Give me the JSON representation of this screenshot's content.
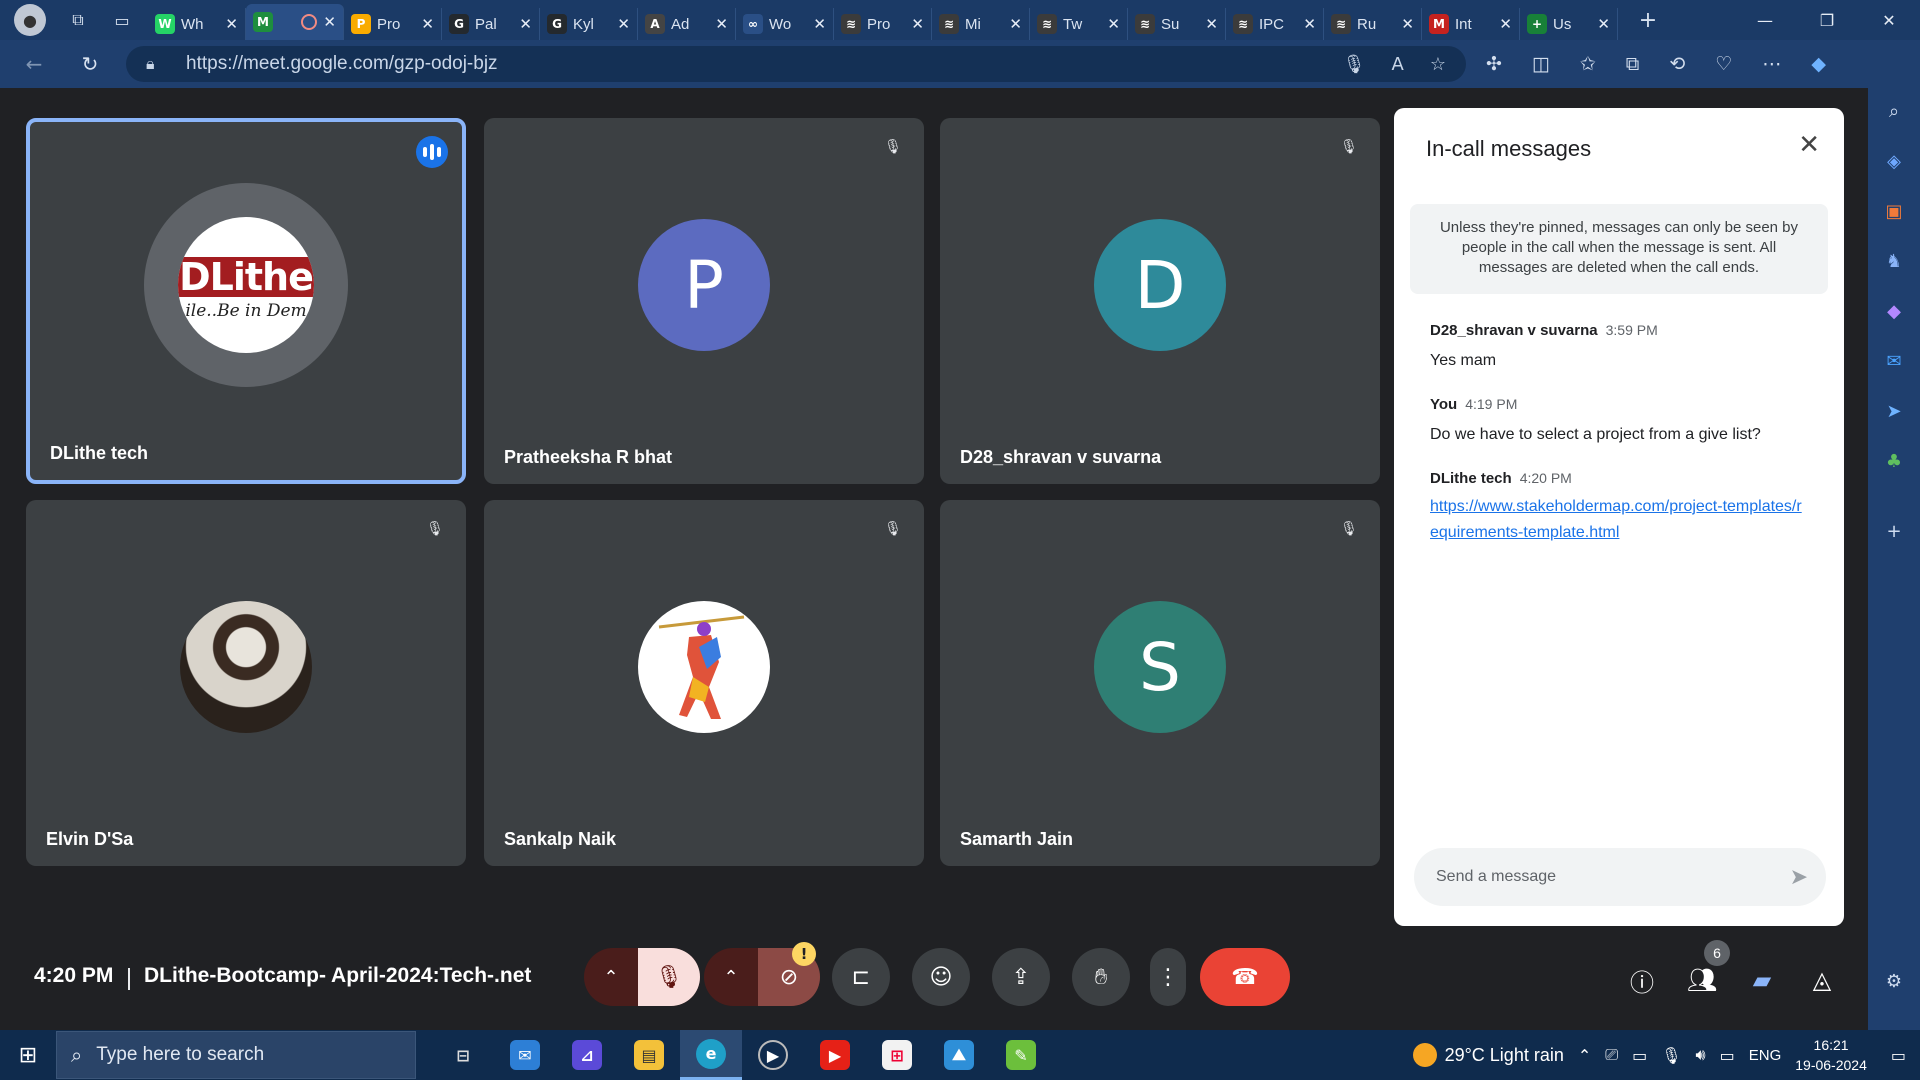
{
  "browser": {
    "tabs": [
      {
        "label": "Wh",
        "fav": "W",
        "color": "#25d366"
      },
      {
        "label": "",
        "fav": "M",
        "color": "#1e8e3e",
        "active": true
      },
      {
        "label": "Pro",
        "fav": "P",
        "color": "#f9ab00"
      },
      {
        "label": "Pal",
        "fav": "G",
        "color": "#24292e"
      },
      {
        "label": "Kyl",
        "fav": "G",
        "color": "#24292e"
      },
      {
        "label": "Ad",
        "fav": "A",
        "color": "#444"
      },
      {
        "label": "Wo",
        "fav": "∞",
        "color": "#2a4f86"
      },
      {
        "label": "Pro",
        "fav": "≋",
        "color": "#3b3b3b"
      },
      {
        "label": "Mi",
        "fav": "≋",
        "color": "#3b3b3b"
      },
      {
        "label": "Tw",
        "fav": "≋",
        "color": "#3b3b3b"
      },
      {
        "label": "Su",
        "fav": "≋",
        "color": "#3b3b3b"
      },
      {
        "label": "IPC",
        "fav": "≋",
        "color": "#3b3b3b"
      },
      {
        "label": "Ru",
        "fav": "≋",
        "color": "#3b3b3b"
      },
      {
        "label": "Int",
        "fav": "M",
        "color": "#c5221f"
      },
      {
        "label": "Us",
        "fav": "+",
        "color": "#188038"
      }
    ],
    "url": "https://meet.google.com/gzp-odoj-bjz"
  },
  "tiles": [
    {
      "name": "DLithe tech",
      "type": "logo",
      "logo_text": "DLithe",
      "logo_tag": "ile..Be in Dem",
      "speaking": true
    },
    {
      "name": "Pratheeksha R bhat",
      "type": "letter",
      "letter": "P",
      "color": "#5c6bc0"
    },
    {
      "name": "D28_shravan v suvarna",
      "type": "letter",
      "letter": "D",
      "color": "#2e8a9a"
    },
    {
      "name": "Elvin D'Sa",
      "type": "photo"
    },
    {
      "name": "Sankalp Naik",
      "type": "art"
    },
    {
      "name": "Samarth Jain",
      "type": "letter",
      "letter": "S",
      "color": "#2f7f74"
    }
  ],
  "panel": {
    "title": "In-call messages",
    "notice": "Unless they're pinned, messages can only be seen by people in the call when the message is sent. All messages are deleted when the call ends.",
    "messages": [
      {
        "sender": "D28_shravan v suvarna",
        "time": "3:59 PM",
        "text": "Yes mam"
      },
      {
        "sender": "You",
        "time": "4:19 PM",
        "text": "Do we have to select a project from a give list?"
      },
      {
        "sender": "DLithe tech",
        "time": "4:20 PM",
        "link": "https://www.stakeholdermap.com/project-templates/requirements-template.html"
      }
    ],
    "input_placeholder": "Send a message"
  },
  "meeting": {
    "time": "4:20 PM",
    "title": "DLithe-Bootcamp- April-2024:Tech-.net",
    "participant_count": "6"
  },
  "taskbar": {
    "search_placeholder": "Type here to search",
    "weather": "29°C  Light rain",
    "lang": "ENG",
    "time": "16:21",
    "date": "19-06-2024"
  }
}
